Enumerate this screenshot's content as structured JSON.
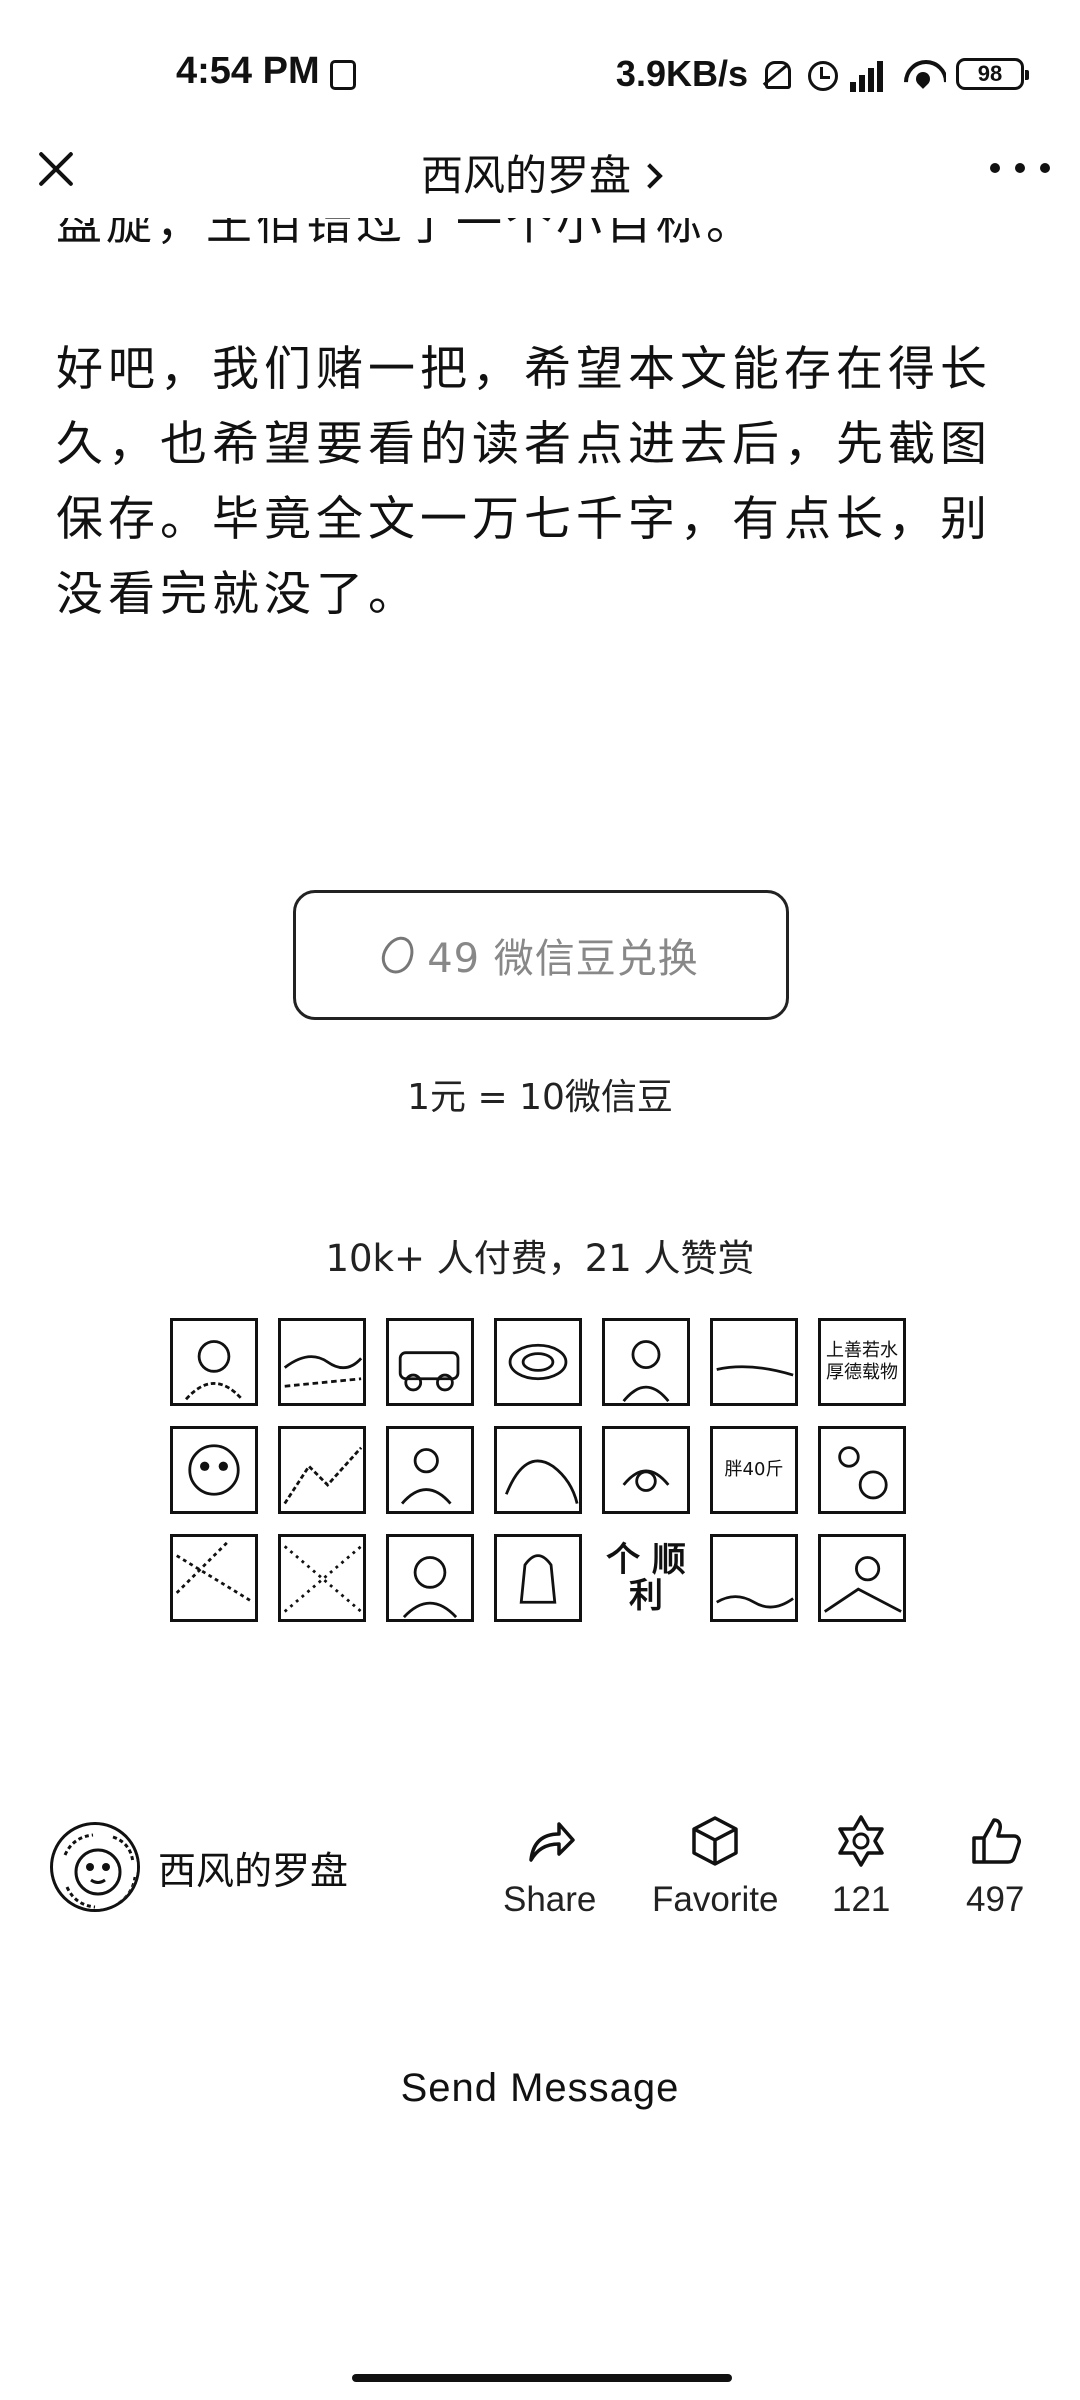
{
  "status_bar": {
    "time": "4:54 PM",
    "network_speed": "3.9KB/s",
    "battery": "98",
    "icons": [
      "sim-icon",
      "mute-bell-icon",
      "alarm-icon",
      "signal-icon",
      "wifi-icon",
      "battery-icon"
    ]
  },
  "header": {
    "title": "西风的罗盘",
    "close_icon": "close-icon",
    "more_icon": "more-icon"
  },
  "article": {
    "cut_off_line": "盘旋，王佰错过了一个小目标。",
    "paragraph": "好吧，我们赌一把，希望本文能存在得长久，也希望要看的读者点进去后，先截图保存。毕竟全文一万七千字，有点长，别没看完就没了。"
  },
  "pay": {
    "button_label": "49 微信豆兑换",
    "rate_text": "1元 = 10微信豆",
    "reward_count": "10k+ 人付费，21 人赞赏"
  },
  "avatars": [
    {
      "type": "photo"
    },
    {
      "type": "photo"
    },
    {
      "type": "photo"
    },
    {
      "type": "photo"
    },
    {
      "type": "photo"
    },
    {
      "type": "photo"
    },
    {
      "type": "text",
      "text": "上善若水 厚德载物"
    },
    {
      "type": "photo"
    },
    {
      "type": "photo"
    },
    {
      "type": "photo"
    },
    {
      "type": "photo"
    },
    {
      "type": "photo"
    },
    {
      "type": "text",
      "text": "胖40斤"
    },
    {
      "type": "photo"
    },
    {
      "type": "photo"
    },
    {
      "type": "photo"
    },
    {
      "type": "photo"
    },
    {
      "type": "photo"
    },
    {
      "type": "text_big",
      "text": "个 顺利"
    },
    {
      "type": "photo"
    },
    {
      "type": "photo"
    }
  ],
  "footer": {
    "author_name": "西风的罗盘",
    "share_label": "Share",
    "favorite_label": "Favorite",
    "wow_count": "121",
    "like_count": "497",
    "send_message": "Send Message"
  }
}
